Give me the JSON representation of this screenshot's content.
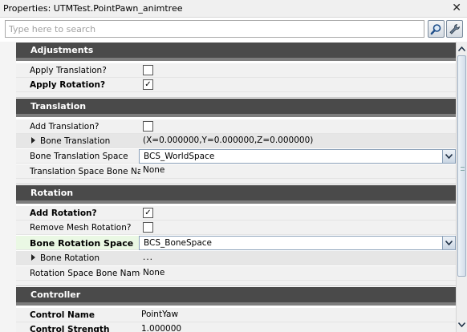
{
  "window": {
    "title": "Properties: UTMTest.PointPawn_animtree",
    "close_glyph": "✕"
  },
  "search": {
    "placeholder": "Type here to search",
    "value": ""
  },
  "icons": {
    "find": "magnifier-icon",
    "options": "wrench-icon",
    "close": "close-icon",
    "dropdown": "chevron-down-icon",
    "expand": "expand-triangle-icon"
  },
  "sections": {
    "adjustments": {
      "label": "Adjustments",
      "rows": {
        "apply_translation": {
          "name": "Apply Translation?",
          "checked": false
        },
        "apply_rotation": {
          "name": "Apply Rotation?",
          "checked": true
        }
      }
    },
    "translation": {
      "label": "Translation",
      "rows": {
        "add_translation": {
          "name": "Add Translation?",
          "checked": false
        },
        "bone_translation": {
          "name": "Bone Translation",
          "value": "(X=0.000000,Y=0.000000,Z=0.000000)"
        },
        "bone_translation_space": {
          "name": "Bone Translation Space",
          "value": "BCS_WorldSpace"
        },
        "translation_space_bone_name": {
          "name": "Translation Space Bone Nam",
          "value": "None"
        }
      }
    },
    "rotation": {
      "label": "Rotation",
      "rows": {
        "add_rotation": {
          "name": "Add Rotation?",
          "checked": true
        },
        "remove_mesh_rotation": {
          "name": "Remove Mesh Rotation?",
          "checked": false
        },
        "bone_rotation_space": {
          "name": "Bone Rotation Space",
          "value": "BCS_BoneSpace"
        },
        "bone_rotation": {
          "name": "Bone Rotation",
          "value": "..."
        },
        "rotation_space_bone_name": {
          "name": "Rotation Space Bone Name",
          "value": "None"
        }
      }
    },
    "controller": {
      "label": "Controller",
      "rows": {
        "control_name": {
          "name": "Control Name",
          "value": "PointYaw"
        },
        "control_strength": {
          "name": "Control Strength",
          "value": "1.000000"
        }
      }
    }
  },
  "check_glyph": "✓"
}
